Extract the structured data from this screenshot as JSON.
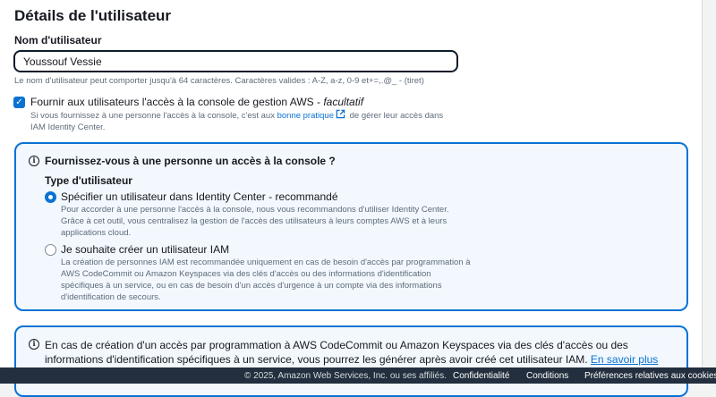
{
  "section": {
    "title": "Détails de l'utilisateur"
  },
  "username": {
    "label": "Nom d'utilisateur",
    "value": "Youssouf Vessie",
    "hint": "Le nom d'utilisateur peut comporter jusqu'à 64 caractères. Caractères valides : A-Z, a-z, 0-9 et+=,.@_ - (tiret)"
  },
  "console_access": {
    "checked": true,
    "label": "Fournir aux utilisateurs l'accès à la console de gestion AWS - ",
    "label_optional": "facultatif",
    "desc_prefix": "Si vous fournissez à une personne l'accès à la console, c'est aux ",
    "desc_link": "bonne pratique",
    "desc_suffix": " de gérer leur accès dans IAM Identity Center."
  },
  "console_question": {
    "title": "Fournissez-vous à une personne un accès à la console ?",
    "user_type_label": "Type d'utilisateur",
    "options": [
      {
        "label": "Spécifier un utilisateur dans Identity Center - recommandé",
        "description": "Pour accorder à une personne l'accès à la console, nous vous recommandons d'utiliser Identity Center. Grâce à cet outil, vous centralisez la gestion de l'accès des utilisateurs à leurs comptes AWS et à leurs applications cloud.",
        "selected": true
      },
      {
        "label": "Je souhaite créer un utilisateur IAM",
        "description": "La création de personnes IAM est recommandée uniquement en cas de besoin d'accès par programmation à AWS CodeCommit ou Amazon Keyspaces via des clés d'accès ou des informations d'identification spécifiques à un service, ou en cas de besoin d'un accès d'urgence à un compte via des informations d'identification de secours.",
        "selected": false
      }
    ]
  },
  "info_box": {
    "text": "En cas de création d'un accès par programmation à AWS CodeCommit ou Amazon Keyspaces via des clés d'accès ou des informations d'identification spécifiques à un service, vous pourrez les générer après avoir créé cet utilisateur IAM. ",
    "link": "En savoir plus"
  },
  "footer": {
    "copyright": "© 2025, Amazon Web Services, Inc. ou ses affiliés.",
    "privacy": "Confidentialité",
    "terms": "Conditions",
    "cookies": "Préférences relatives aux cookies"
  },
  "colors": {
    "accent": "#0972d3",
    "footer_bg": "#232f3e",
    "info_bg": "#f2f8fd"
  }
}
